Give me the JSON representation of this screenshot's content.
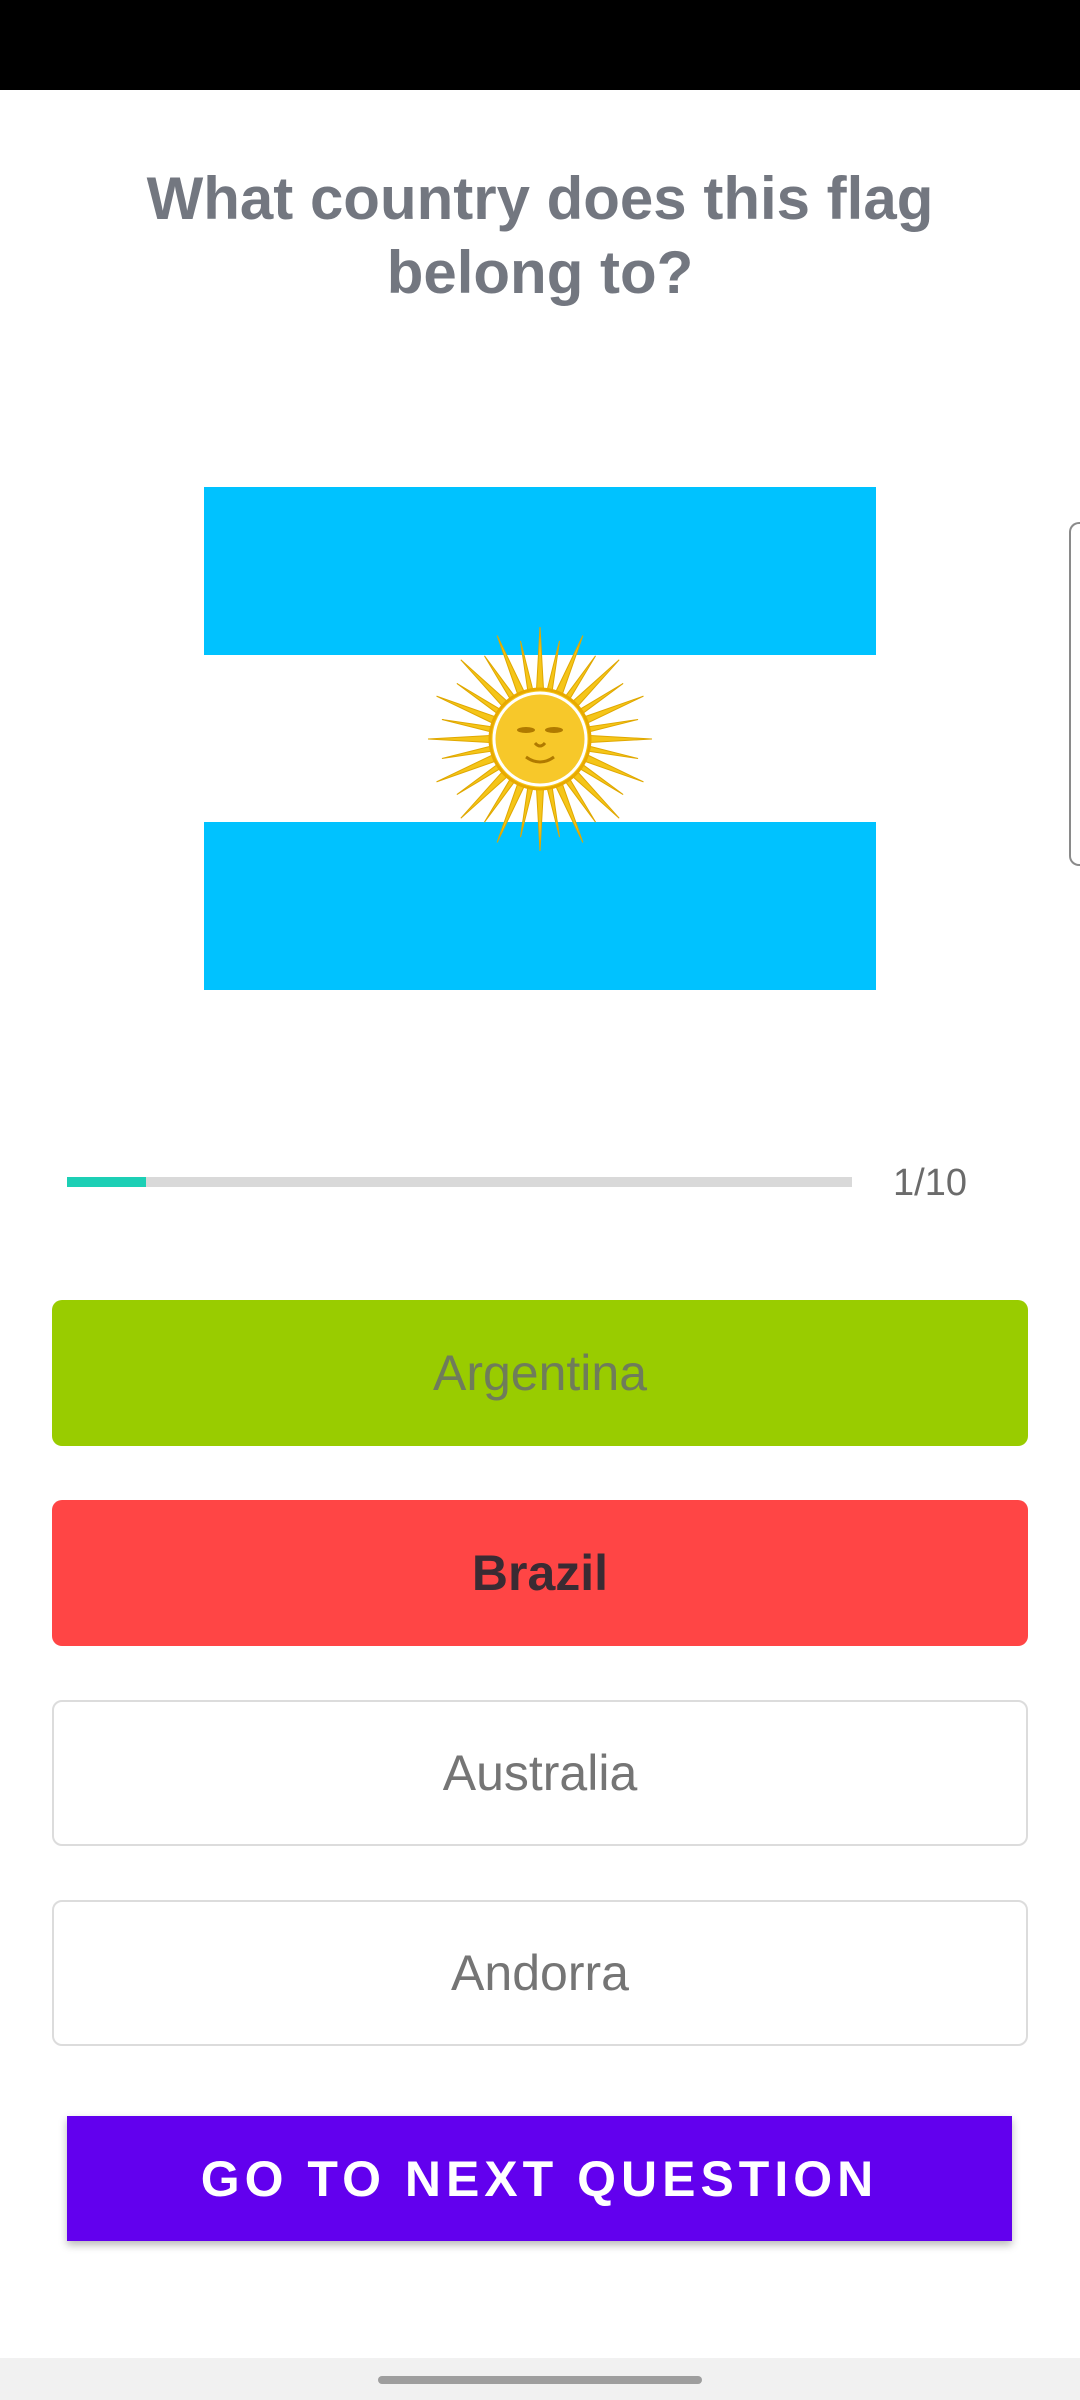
{
  "quiz": {
    "question": "What country does this flag belong to?",
    "progress": {
      "label": "1/10",
      "fraction": 0.1
    },
    "options": [
      {
        "label": "Argentina",
        "state": "correct"
      },
      {
        "label": "Brazil",
        "state": "wrong"
      },
      {
        "label": "Australia",
        "state": "neutral"
      },
      {
        "label": "Andorra",
        "state": "neutral"
      }
    ],
    "next_button_label": "GO TO NEXT QUESTION"
  },
  "flag": {
    "icon": "argentina-flag",
    "colors": {
      "stripe": "#00c2ff",
      "sun": "#f5c518"
    }
  },
  "colors": {
    "correct": "#99cc00",
    "wrong": "#ff4545",
    "accent": "#6200ee",
    "progress": "#1ccfb5"
  }
}
